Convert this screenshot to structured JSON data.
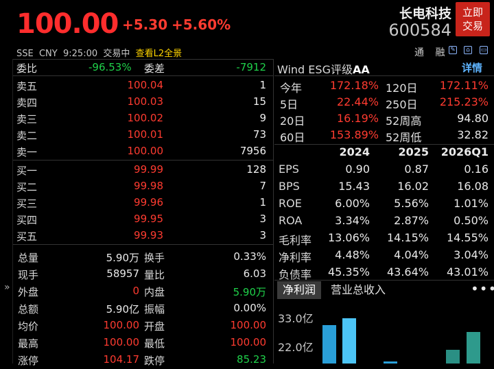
{
  "header": {
    "price": "100.00",
    "change": "+5.30",
    "change_pct": "+5.60%",
    "exchange": "SSE",
    "currency": "CNY",
    "time": "9:25:00",
    "status": "交易中",
    "l2_link": "查看L2全景",
    "stock_name": "长电科技",
    "stock_code": "600584",
    "trade_button": [
      "立即",
      "交易"
    ],
    "tong_label": "通 融"
  },
  "orderbook": {
    "weibi_label": "委比",
    "weibi_value": "-96.53%",
    "weicha_label": "委差",
    "weicha_value": "-7912",
    "asks": [
      {
        "label": "卖五",
        "price": "100.04",
        "vol": "1"
      },
      {
        "label": "卖四",
        "price": "100.03",
        "vol": "15"
      },
      {
        "label": "卖三",
        "price": "100.02",
        "vol": "9"
      },
      {
        "label": "卖二",
        "price": "100.01",
        "vol": "73"
      },
      {
        "label": "卖一",
        "price": "100.00",
        "vol": "7956"
      }
    ],
    "bids": [
      {
        "label": "买一",
        "price": "99.99",
        "vol": "128"
      },
      {
        "label": "买二",
        "price": "99.98",
        "vol": "7"
      },
      {
        "label": "买三",
        "price": "99.96",
        "vol": "1"
      },
      {
        "label": "买四",
        "price": "99.95",
        "vol": "3"
      },
      {
        "label": "买五",
        "price": "99.93",
        "vol": "3"
      }
    ]
  },
  "stats": [
    {
      "k1": "总量",
      "v1": "5.90万",
      "c1": "white",
      "k2": "换手",
      "v2": "0.33%",
      "c2": "white"
    },
    {
      "k1": "现手",
      "v1": "58957",
      "c1": "white",
      "k2": "量比",
      "v2": "6.03",
      "c2": "white"
    },
    {
      "k1": "外盘",
      "v1": "0",
      "c1": "red",
      "k2": "内盘",
      "v2": "5.90万",
      "c2": "green"
    },
    {
      "k1": "总额",
      "v1": "5.90亿",
      "c1": "white",
      "k2": "振幅",
      "v2": "0.00%",
      "c2": "white"
    },
    {
      "k1": "均价",
      "v1": "100.00",
      "c1": "red",
      "k2": "开盘",
      "v2": "100.00",
      "c2": "red"
    },
    {
      "k1": "最高",
      "v1": "100.00",
      "c1": "red",
      "k2": "最低",
      "v2": "100.00",
      "c2": "red"
    },
    {
      "k1": "涨停",
      "v1": "104.17",
      "c1": "red",
      "k2": "跌停",
      "v2": "85.23",
      "c2": "green"
    }
  ],
  "right": {
    "esg_label": "Wind ESG评级",
    "esg_rating": "AA",
    "detail_label": "详情",
    "perf": [
      {
        "k1": "今年",
        "v1": "172.18%",
        "k2": "120日",
        "v2": "172.11%"
      },
      {
        "k1": "5日",
        "v1": "22.44%",
        "k2": "250日",
        "v2": "215.23%"
      },
      {
        "k1": "20日",
        "v1": "16.19%",
        "k2": "52周高",
        "v2": "94.80"
      },
      {
        "k1": "60日",
        "v1": "153.89%",
        "k2": "52周低",
        "v2": "32.82"
      }
    ],
    "fin_headers": [
      "2024",
      "2025",
      "2026Q1"
    ],
    "fin_rows": [
      {
        "k": "EPS",
        "a": "0.90",
        "b": "0.87",
        "c": "0.16"
      },
      {
        "k": "BPS",
        "a": "15.43",
        "b": "16.02",
        "c": "16.08"
      },
      {
        "k": "ROE",
        "a": "6.00%",
        "b": "5.56%",
        "c": "1.01%"
      },
      {
        "k": "ROA",
        "a": "3.34%",
        "b": "2.87%",
        "c": "0.50%"
      },
      {
        "k": "毛利率",
        "a": "13.06%",
        "b": "14.15%",
        "c": "14.55%"
      },
      {
        "k": "净利率",
        "a": "4.48%",
        "b": "4.04%",
        "c": "3.04%"
      },
      {
        "k": "负债率",
        "a": "45.35%",
        "b": "43.64%",
        "c": "43.01%"
      }
    ],
    "tabs": [
      "净利润",
      "营业总收入"
    ],
    "more": "•••",
    "axis_labels": [
      "33.0亿",
      "22.0亿"
    ]
  }
}
